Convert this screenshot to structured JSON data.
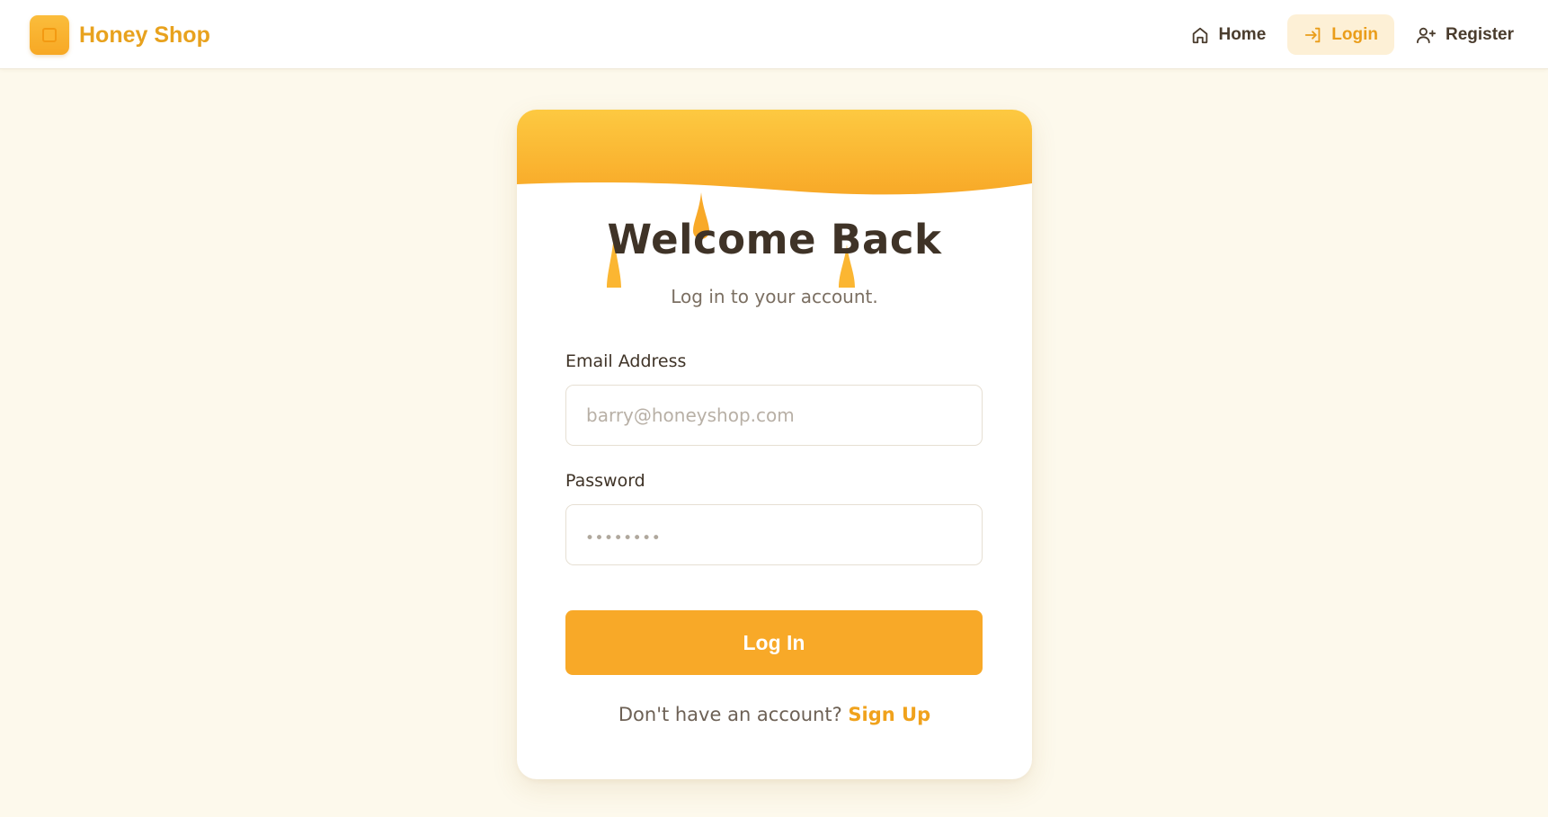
{
  "header": {
    "brand_name": "Honey Shop",
    "nav": [
      {
        "label": "Home",
        "icon": "home-icon",
        "active": false
      },
      {
        "label": "Login",
        "icon": "login-icon",
        "active": true
      },
      {
        "label": "Register",
        "icon": "user-plus-icon",
        "active": false
      }
    ]
  },
  "card": {
    "title": "Welcome Back",
    "subtitle": "Log in to your account.",
    "email_label": "Email Address",
    "email_placeholder": "barry@honeyshop.com",
    "password_label": "Password",
    "password_placeholder": "••••••••",
    "submit_label": "Log In",
    "signup_prompt": "Don't have an account?",
    "signup_link": "Sign Up"
  },
  "colors": {
    "accent": "#f8a928",
    "brand_text": "#e8a21e",
    "background": "#fdf9ec",
    "active_nav_bg": "#fdf0d6"
  }
}
